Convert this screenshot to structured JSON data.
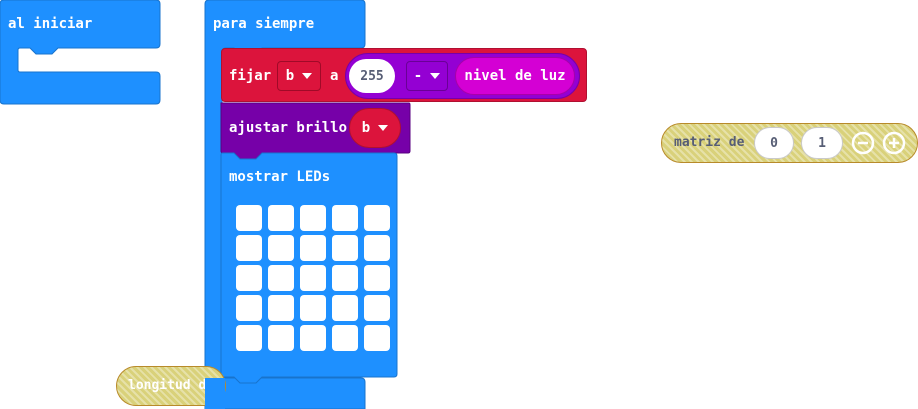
{
  "colors": {
    "basic_blue": "#1E90FF",
    "variables_red": "#DC143C",
    "math_purple": "#9400D3",
    "input_magenta": "#D400D4",
    "led_brightness_purple": "#7600A8",
    "array_olive": "#E65722",
    "hatch_base": "#d9d17a"
  },
  "blocks": {
    "on_start": {
      "label": "al iniciar"
    },
    "forever": {
      "label": "para siempre"
    },
    "set_var": {
      "label_set": "fijar",
      "var_name": "b",
      "label_to": "a",
      "number": "255",
      "operator": "-",
      "sensor_label": "nivel de luz"
    },
    "set_brightness": {
      "label": "ajustar brillo",
      "var_name": "b"
    },
    "show_leds": {
      "label": "mostrar LEDs"
    },
    "array_of": {
      "label": "matriz de",
      "values": [
        "0",
        "1"
      ]
    },
    "length_of": {
      "label": "longitud d"
    }
  }
}
